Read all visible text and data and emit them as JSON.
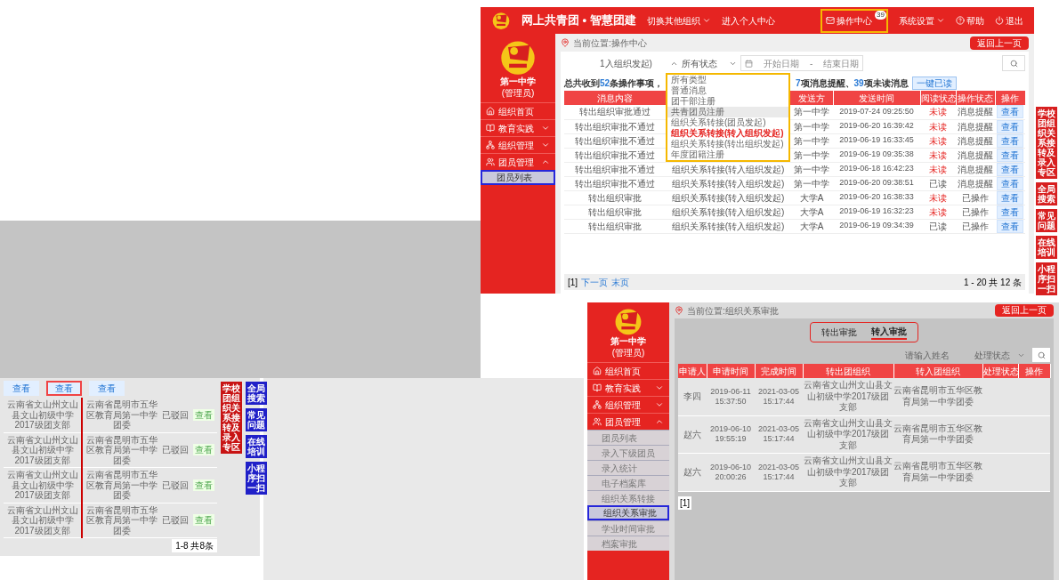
{
  "top_screen": {
    "header": {
      "title": "网上共青团 • 智慧团建",
      "nav": [
        {
          "label": "切换其他组织",
          "dropdown": true
        },
        {
          "label": "进入个人中心",
          "dropdown": false
        }
      ],
      "actions": [
        {
          "kind": "mail",
          "label": "操作中心",
          "badge": "39"
        },
        {
          "kind": "menu",
          "label": "系统设置"
        },
        {
          "kind": "help",
          "label": "帮助"
        },
        {
          "kind": "power",
          "label": "退出"
        }
      ]
    },
    "sidebar": {
      "org": "第一中学",
      "role": "(管理员)",
      "items": [
        {
          "label": "组织首页"
        },
        {
          "label": "教育实践",
          "expanded": false
        },
        {
          "label": "组织管理",
          "expanded": false
        },
        {
          "label": "团员管理",
          "expanded": true,
          "children": [
            {
              "label": "团员列表",
              "selected": true
            }
          ]
        }
      ]
    },
    "breadcrumb": "当前位置:操作中心",
    "back_button": "返回上一页",
    "filters": {
      "type": "1入组织发起)",
      "status": "所有状态",
      "start_placeholder": "开始日期",
      "separator": "-",
      "end_placeholder": "结束日期"
    },
    "type_menu": [
      {
        "label": "所有类型",
        "selected": false,
        "highlighted": false
      },
      {
        "label": "普通消息",
        "selected": false,
        "highlighted": false
      },
      {
        "label": "团干部注册",
        "selected": false,
        "highlighted": false
      },
      {
        "label": "共青团员注册",
        "selected": false,
        "highlighted": true
      },
      {
        "label": "组织关系转接(团员发起)",
        "selected": false,
        "highlighted": false
      },
      {
        "label": "组织关系转接(转入组织发起)",
        "selected": true,
        "highlighted": false
      },
      {
        "label": "组织关系转接(转出组织发起)",
        "selected": false,
        "highlighted": false
      },
      {
        "label": "年度团籍注册",
        "selected": false,
        "highlighted": false
      }
    ],
    "summary": {
      "prefix": "总共收到",
      "total": "52",
      "mid": "条操作事项，",
      "reminders": "7",
      "reminders_label": "项消息提醒、",
      "unread": "39",
      "unread_label": "项未读消息",
      "button": "一键已读"
    },
    "table": {
      "columns": [
        "消息内容",
        "发送方",
        "发送时间",
        "阅读状态",
        "操作状态",
        "操作"
      ],
      "rows": [
        {
          "message": "转出组织审批通过",
          "sender": "第一中学",
          "time": "2019-07-24 09:25:50",
          "read_label": "未读",
          "read": false,
          "op_status": "消息提醒",
          "action": "查看"
        },
        {
          "message": "转出组织审批不通过",
          "sender": "第一中学",
          "time": "2019-06-20 16:39:42",
          "read_label": "未读",
          "read": false,
          "op_status": "消息提醒",
          "action": "查看"
        },
        {
          "message": "转出组织审批不通过",
          "sender": "第一中学",
          "time": "2019-06-19 16:33:45",
          "read_label": "未读",
          "read": false,
          "op_status": "消息提醒",
          "action": "查看"
        },
        {
          "message": "转出组织审批不通过",
          "sender": "第一中学",
          "time": "2019-06-19 09:35:38",
          "read_label": "未读",
          "read": false,
          "op_status": "消息提醒",
          "action": "查看"
        },
        {
          "message": "转出组织审批不通过",
          "type": "组织关系转接(转入组织发起)",
          "sender": "第一中学",
          "time": "2019-06-18 16:42:23",
          "read_label": "未读",
          "read": false,
          "op_status": "消息提醒",
          "action": "查看"
        },
        {
          "message": "转出组织审批不通过",
          "type": "组织关系转接(转入组织发起)",
          "sender": "第一中学",
          "time": "2019-06-20 09:38:51",
          "read_label": "已读",
          "read": true,
          "op_status": "消息提醒",
          "action": "查看"
        },
        {
          "message": "转出组织审批",
          "type": "组织关系转接(转入组织发起)",
          "sender": "大学A",
          "time": "2019-06-20 16:38:33",
          "read_label": "未读",
          "read": false,
          "op_status": "已操作",
          "action": "查看"
        },
        {
          "message": "转出组织审批",
          "type": "组织关系转接(转入组织发起)",
          "sender": "大学A",
          "time": "2019-06-19 16:32:23",
          "read_label": "未读",
          "read": false,
          "op_status": "已操作",
          "action": "查看"
        },
        {
          "message": "转出组织审批",
          "type": "组织关系转接(转入组织发起)",
          "sender": "大学A",
          "time": "2019-06-19 09:34:39",
          "read_label": "已读",
          "read": true,
          "op_status": "已操作",
          "action": "查看"
        }
      ]
    },
    "pagination": {
      "page": "[1]",
      "next": "下一页",
      "last": "末页",
      "info": "1 - 20 共 12 条"
    },
    "float_links": [
      {
        "label": "学校团组织关系接转及录入专区",
        "color": "#d71f1f"
      },
      {
        "label": "全局搜索",
        "color": "#d71f1f"
      },
      {
        "label": "常见问题",
        "color": "#d71f1f"
      },
      {
        "label": "在线培训",
        "color": "#d71f1f"
      },
      {
        "label": "小程序扫一扫",
        "color": "#d71f1f"
      }
    ]
  },
  "approval_screen": {
    "sidebar": {
      "org": "第一中学",
      "role": "(管理员)",
      "items": [
        {
          "label": "组织首页"
        },
        {
          "label": "教育实践",
          "expanded": false
        },
        {
          "label": "组织管理",
          "expanded": false
        },
        {
          "label": "团员管理",
          "expanded": true,
          "children": [
            {
              "label": "团员列表",
              "selected": false
            },
            {
              "label": "录入下级团员",
              "selected": false
            },
            {
              "label": "录入统计",
              "selected": false
            },
            {
              "label": "电子档案库",
              "selected": false
            },
            {
              "label": "组织关系转接",
              "selected": false
            },
            {
              "label": "组织关系审批",
              "selected": true
            },
            {
              "label": "学业时间审批",
              "selected": false
            },
            {
              "label": "档案审批",
              "selected": false
            }
          ]
        }
      ]
    },
    "breadcrumb": "当前位置:组织关系审批",
    "back_button": "返回上一页",
    "tabs": [
      {
        "label": "转出审批",
        "selected": false
      },
      {
        "label": "转入审批",
        "selected": true
      }
    ],
    "name_placeholder": "请输入姓名",
    "status_label": "处理状态",
    "table": {
      "columns": [
        "申请人",
        "申请时间",
        "完成时间",
        "转出团组织",
        "转入团组织",
        "处理状态",
        "操作"
      ],
      "rows": [
        {
          "applicant": "李四",
          "applied": "2019-06-11 15:37:50",
          "completed": "2021-03-05 15:17:44",
          "from": "云南省文山州文山县文山初级中学2017级团支部",
          "to": "云南省昆明市五华区教育局第一中学团委"
        },
        {
          "applicant": "赵六",
          "applied": "2019-06-10 19:55:19",
          "completed": "2021-03-05 15:17:44",
          "from": "云南省文山州文山县文山初级中学2017级团支部",
          "to": "云南省昆明市五华区教育局第一中学团委"
        },
        {
          "applicant": "赵六",
          "applied": "2019-06-10 20:00:26",
          "completed": "2021-03-05 15:17:44",
          "from": "云南省文山州文山县文山初级中学2017级团支部",
          "to": "云南省昆明市五华区教育局第一中学团委"
        }
      ]
    },
    "pagination": {
      "page": "[1]"
    }
  },
  "fragment": {
    "view_buttons": [
      {
        "label": "查看",
        "selected": false
      },
      {
        "label": "查看",
        "selected": true
      },
      {
        "label": "查看",
        "selected": false
      }
    ],
    "rows": [
      {
        "from": "云南省文山州文山县文山初级中学2017级团支部",
        "to": "云南省昆明市五华区教育局第一中学团委",
        "status": "已驳回",
        "action": "查看"
      },
      {
        "from": "云南省文山州文山县文山初级中学2017级团支部",
        "to": "云南省昆明市五华区教育局第一中学团委",
        "status": "已驳回",
        "action": "查看"
      },
      {
        "from": "云南省文山州文山县文山初级中学2017级团支部",
        "to": "云南省昆明市五华区教育局第一中学团委",
        "status": "已驳回",
        "action": "查看"
      },
      {
        "from": "云南省文山州文山县文山初级中学2017级团支部",
        "to": "云南省昆明市五华区教育局第一中学团委",
        "status": "已驳回",
        "action": "查看"
      }
    ],
    "info": "1-8 共8条",
    "float_links": [
      {
        "label": "学校团组织关系接转及录入专区",
        "color": "#c81414"
      },
      {
        "label": "全局搜索",
        "color": "#2020c8"
      },
      {
        "label": "常见问题",
        "color": "#2020c8"
      },
      {
        "label": "在线培训",
        "color": "#2020c8"
      },
      {
        "label": "小程序扫一扫",
        "color": "#2020c8"
      }
    ]
  }
}
